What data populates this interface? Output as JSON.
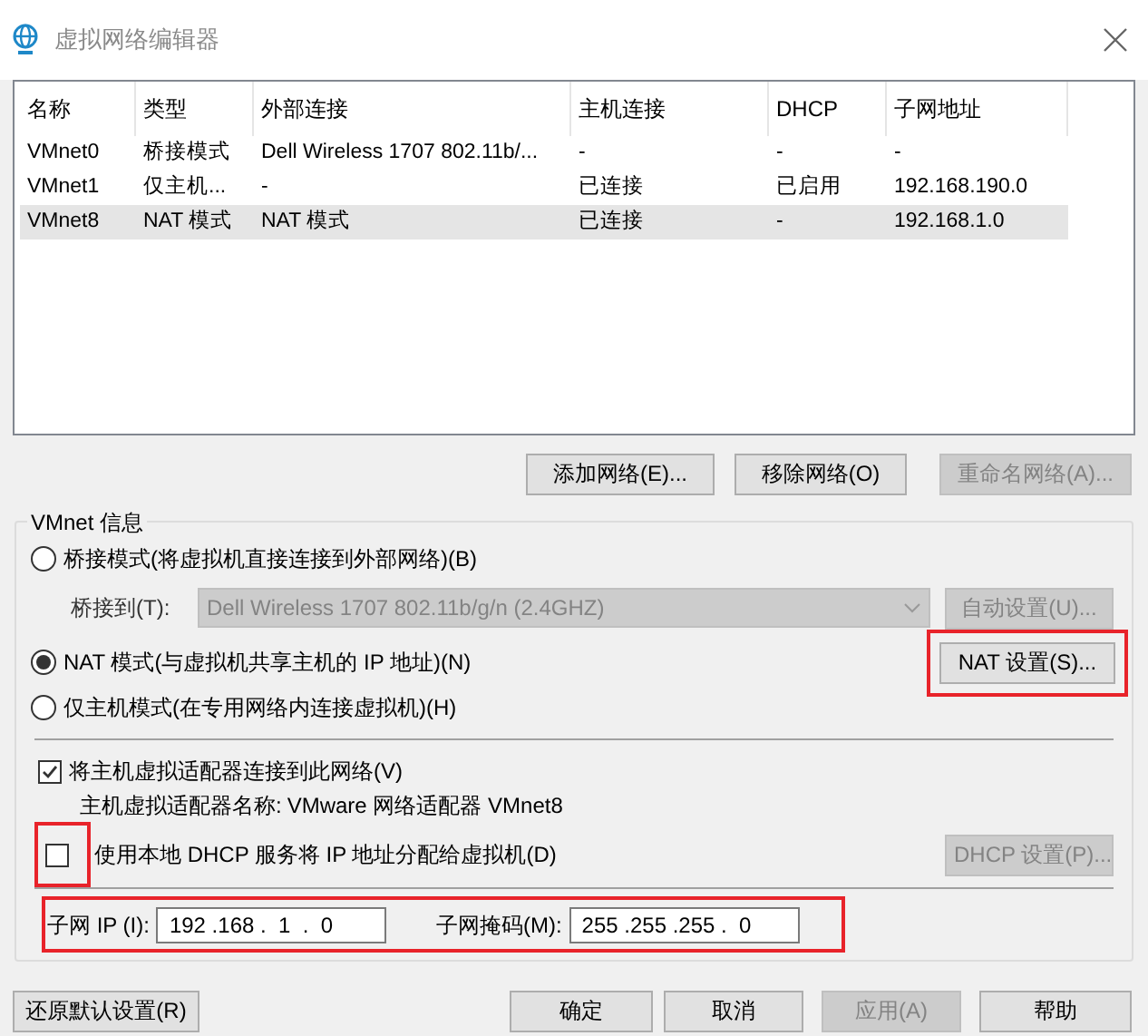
{
  "window": {
    "title": "虚拟网络编辑器"
  },
  "table": {
    "columns": [
      "名称",
      "类型",
      "外部连接",
      "主机连接",
      "DHCP",
      "子网地址"
    ],
    "rows": [
      {
        "cells": [
          "VMnet0",
          "桥接模式",
          "Dell Wireless 1707 802.11b/...",
          "-",
          "-",
          "-"
        ],
        "selected": false
      },
      {
        "cells": [
          "VMnet1",
          "仅主机...",
          "-",
          "已连接",
          "已启用",
          "192.168.190.0"
        ],
        "selected": false
      },
      {
        "cells": [
          "VMnet8",
          "NAT 模式",
          "NAT 模式",
          "已连接",
          "-",
          "192.168.1.0"
        ],
        "selected": true
      }
    ]
  },
  "list_buttons": [
    {
      "label": "添加网络(E)...",
      "disabled": false
    },
    {
      "label": "移除网络(O)",
      "disabled": false
    },
    {
      "label": "重命名网络(A)...",
      "disabled": true
    }
  ],
  "group": {
    "title": "VMnet 信息",
    "modes": [
      {
        "label": "桥接模式(将虚拟机直接连接到外部网络)(B)",
        "selected": false
      },
      {
        "label": "NAT 模式(与虚拟机共享主机的 IP 地址)(N)",
        "selected": true
      },
      {
        "label": "仅主机模式(在专用网络内连接虚拟机)(H)",
        "selected": false
      }
    ],
    "bridge_to": {
      "label": "桥接到(T):",
      "value": "Dell Wireless 1707 802.11b/g/n (2.4GHZ)",
      "disabled": true
    },
    "auto_button": {
      "label": "自动设置(U)...",
      "disabled": true
    },
    "nat_button": {
      "label": "NAT 设置(S)...",
      "disabled": false,
      "highlighted": true
    },
    "connect_adapter": {
      "label": "将主机虚拟适配器连接到此网络(V)",
      "checked": true
    },
    "adapter_name": {
      "label": "主机虚拟适配器名称:",
      "value": "VMware 网络适配器 VMnet8"
    },
    "use_dhcp": {
      "label": "使用本地 DHCP 服务将 IP 地址分配给虚拟机(D)",
      "checked": false,
      "highlighted": true
    },
    "dhcp_button": {
      "label": "DHCP 设置(P)...",
      "disabled": true
    },
    "subnet": {
      "highlighted": true,
      "ip_label": "子网 IP (I):",
      "ip": "192 .168 .  1  .  0",
      "mask_label": "子网掩码(M):",
      "mask": "255 .255 .255 .  0"
    }
  },
  "footer_buttons": [
    {
      "label": "还原默认设置(R)",
      "disabled": false
    },
    {
      "label": "确定",
      "disabled": false
    },
    {
      "label": "取消",
      "disabled": false
    },
    {
      "label": "应用(A)",
      "disabled": true
    },
    {
      "label": "帮助",
      "disabled": false
    }
  ]
}
